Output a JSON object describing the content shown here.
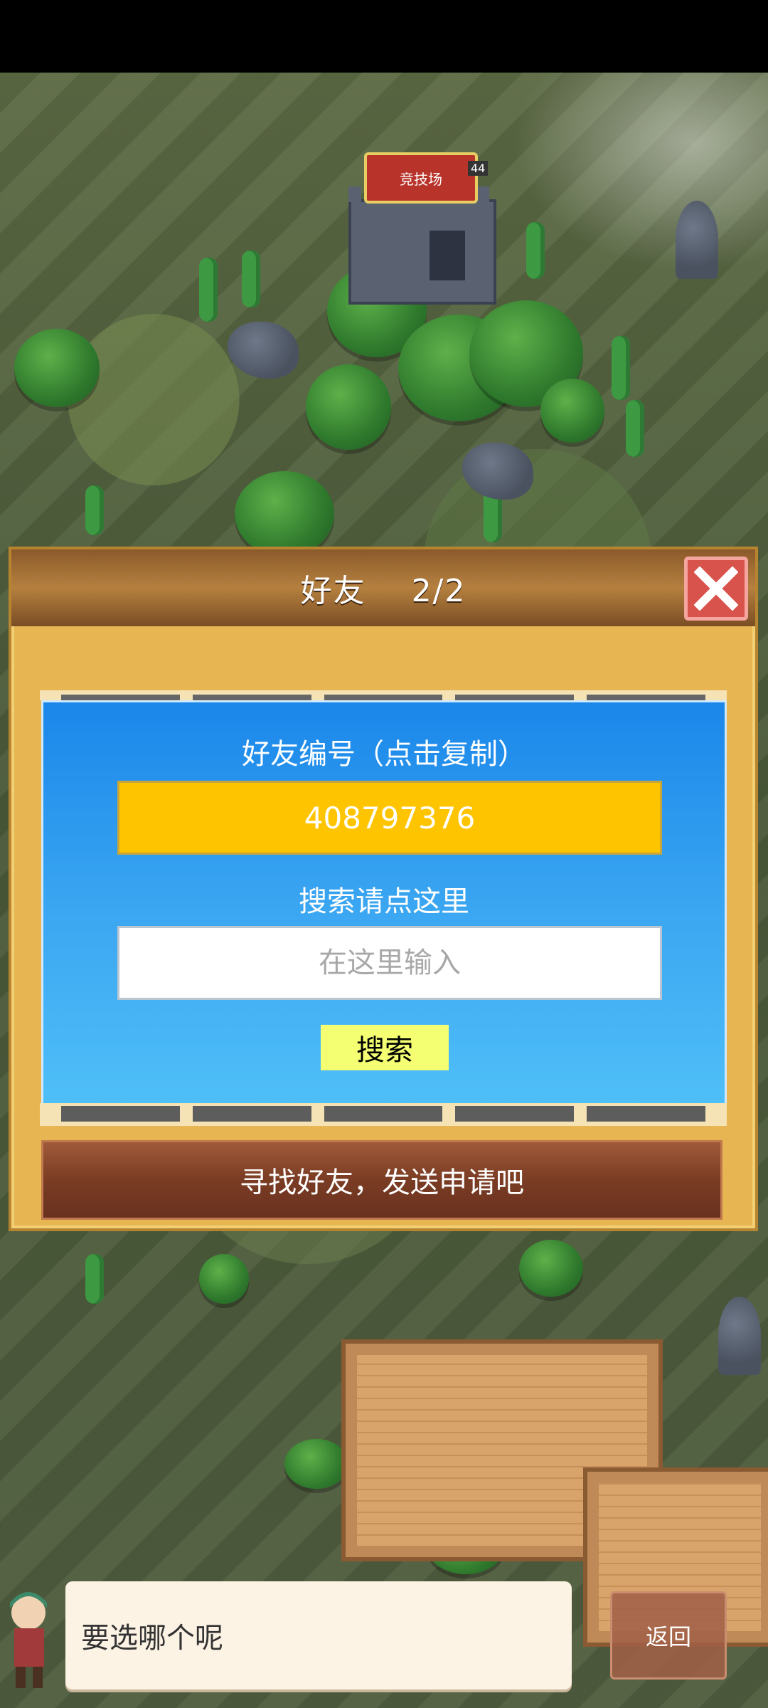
{
  "map": {
    "arena_label": "竞技场",
    "arena_level": "44"
  },
  "dialog": {
    "title": "好友",
    "count": "2/2"
  },
  "friend_panel": {
    "id_heading": "好友编号（点击复制）",
    "friend_id": "408797376",
    "search_heading": "搜索请点这里",
    "search_placeholder": "在这里输入",
    "search_button_label": "搜索"
  },
  "find_friends_label": "寻找好友，发送申请吧",
  "bottom": {
    "message": "要选哪个呢",
    "back_label": "返回"
  },
  "colors": {
    "panel_blue": "#1a87ea",
    "id_box": "#ffc400",
    "search_button": "#f5ff72",
    "close_button": "#d9534d",
    "dialog_bg": "#e7b653"
  }
}
